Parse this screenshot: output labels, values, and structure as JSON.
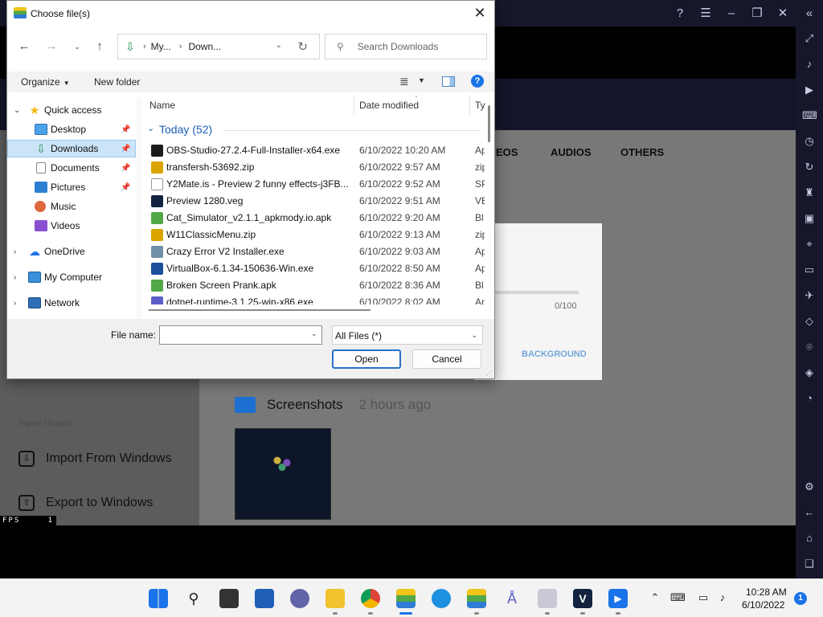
{
  "dialog": {
    "title": "Choose file(s)",
    "breadcrumb": [
      "My...",
      "Down..."
    ],
    "search_placeholder": "Search Downloads",
    "toolbar": {
      "organize": "Organize",
      "new_folder": "New folder"
    },
    "nav": {
      "quick_access": "Quick access",
      "items": [
        {
          "label": "Desktop",
          "icon": "desktop-icon"
        },
        {
          "label": "Downloads",
          "icon": "downloads-icon"
        },
        {
          "label": "Documents",
          "icon": "documents-icon"
        },
        {
          "label": "Pictures",
          "icon": "pictures-icon"
        },
        {
          "label": "Music",
          "icon": "music-icon"
        },
        {
          "label": "Videos",
          "icon": "videos-icon"
        }
      ],
      "onedrive": "OneDrive",
      "my_computer": "My Computer",
      "network": "Network"
    },
    "columns": {
      "name": "Name",
      "date": "Date modified",
      "type": "Ty"
    },
    "group_label": "Today (52)",
    "files": [
      {
        "name": "OBS-Studio-27.2.4-Full-Installer-x64.exe",
        "date": "6/10/2022 10:20 AM",
        "type": "Ap",
        "icon": "obs-icon",
        "color": "#1b1b1b"
      },
      {
        "name": "transfersh-53692.zip",
        "date": "6/10/2022 9:57 AM",
        "type": "zip",
        "icon": "zip-icon",
        "color": "#d9a400"
      },
      {
        "name": "Y2Mate.is - Preview 2 funny effects-j3FB...",
        "date": "6/10/2022 9:52 AM",
        "type": "SP",
        "icon": "file-icon",
        "color": "#ffffff"
      },
      {
        "name": "Preview 1280.veg",
        "date": "6/10/2022 9:51 AM",
        "type": "VE",
        "icon": "vegas-icon",
        "color": "#13233f"
      },
      {
        "name": "Cat_Simulator_v2.1.1_apkmody.io.apk",
        "date": "6/10/2022 9:20 AM",
        "type": "Bl",
        "icon": "bluestacks-apk-icon",
        "color": "#52a846"
      },
      {
        "name": "W11ClassicMenu.zip",
        "date": "6/10/2022 9:13 AM",
        "type": "zip",
        "icon": "zip-icon",
        "color": "#d9a400"
      },
      {
        "name": "Crazy Error V2 Installer.exe",
        "date": "6/10/2022 9:03 AM",
        "type": "Ap",
        "icon": "installer-icon",
        "color": "#6f8fa8"
      },
      {
        "name": "VirtualBox-6.1.34-150636-Win.exe",
        "date": "6/10/2022 8:50 AM",
        "type": "Ap",
        "icon": "virtualbox-icon",
        "color": "#1b4f9b"
      },
      {
        "name": "Broken Screen Prank.apk",
        "date": "6/10/2022 8:36 AM",
        "type": "Bl",
        "icon": "bluestacks-apk-icon",
        "color": "#52a846"
      },
      {
        "name": "dotnet-runtime-3.1.25-win-x86.exe",
        "date": "6/10/2022 8:02 AM",
        "type": "Ap",
        "icon": "installer-icon",
        "color": "#5b5fc7"
      }
    ],
    "file_name_label": "File name:",
    "file_name_value": "",
    "file_type": "All Files (*)",
    "open_label": "Open",
    "cancel_label": "Cancel"
  },
  "app": {
    "tabs": [
      "EOS",
      "AUDIOS",
      "OTHERS"
    ],
    "progress_text": "0/100",
    "progress_value": 0,
    "background_label": "BACKGROUND",
    "folder_name": "Screenshots",
    "folder_time": "2 hours ago",
    "import_export_label": "Import / Export",
    "import_label": "Import From Windows",
    "export_label": "Export to Windows",
    "fps_label": "FPS",
    "fps_value": "1"
  },
  "taskbar": {
    "time": "10:28 AM",
    "date": "6/10/2022",
    "notifications": "1"
  }
}
